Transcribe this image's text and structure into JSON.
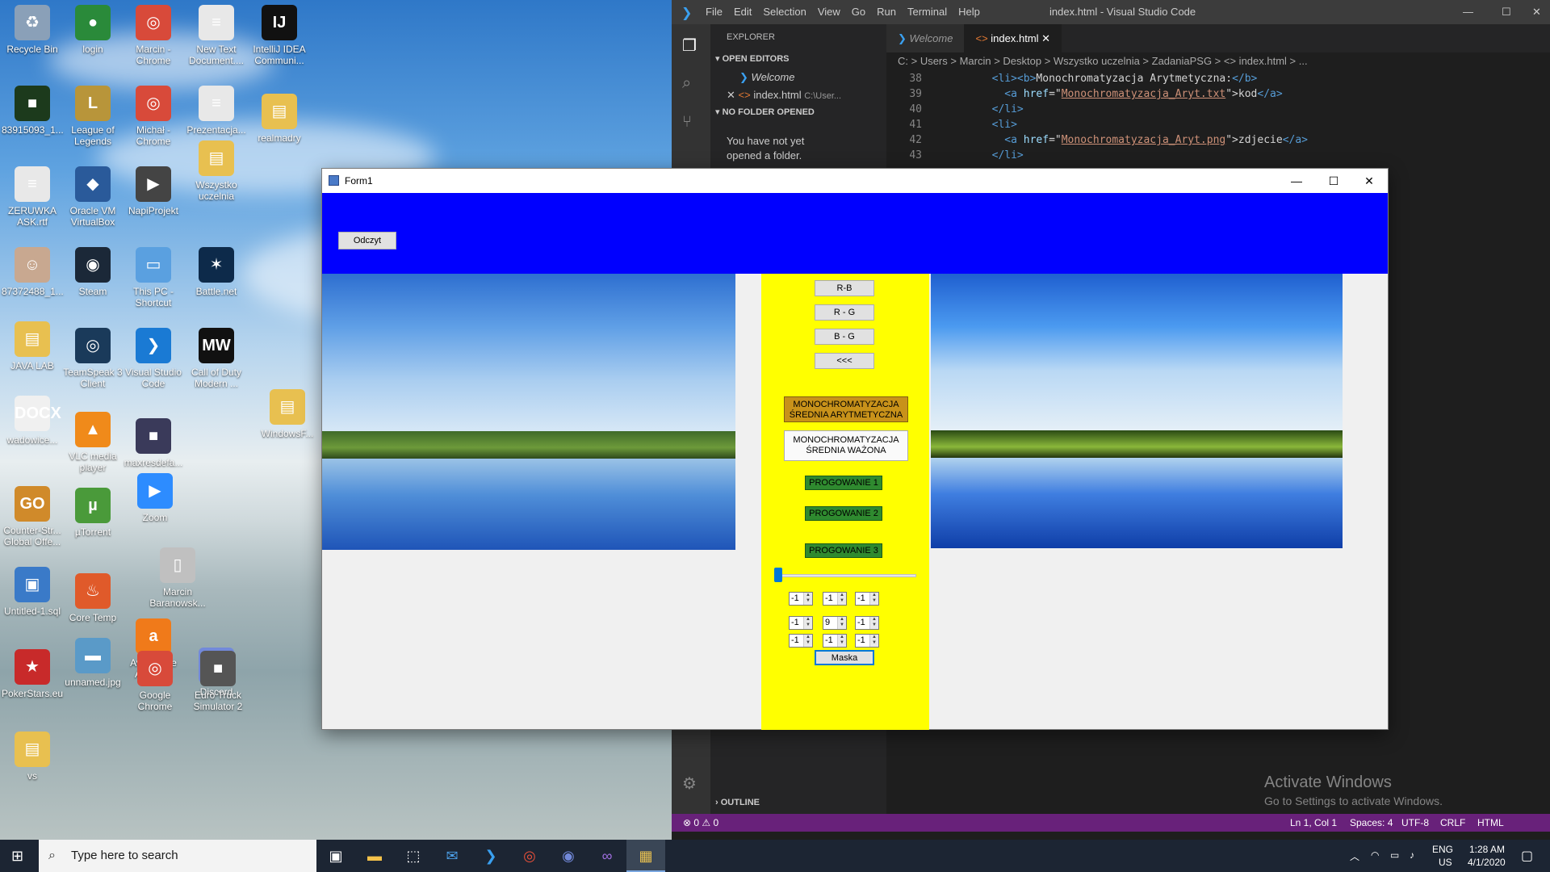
{
  "desktop": {
    "icons": [
      {
        "label": "Recycle Bin",
        "glyph": "♻",
        "color": "#8aa0b8"
      },
      {
        "label": "login",
        "glyph": "●",
        "color": "#2a8a3a"
      },
      {
        "label": "Marcin - Chrome",
        "glyph": "◎",
        "color": "#d84a3a"
      },
      {
        "label": "New Text Document....",
        "glyph": "≡",
        "color": "#e8e8e8"
      },
      {
        "label": "IntelliJ IDEA Communi...",
        "glyph": "IJ",
        "color": "#111111"
      },
      {
        "label": "83915093_1...",
        "glyph": "■",
        "color": "#1c3a1c"
      },
      {
        "label": "League of Legends",
        "glyph": "L",
        "color": "#b8953a"
      },
      {
        "label": "Michał - Chrome",
        "glyph": "◎",
        "color": "#d84a3a"
      },
      {
        "label": "Prezentacja...",
        "glyph": "≡",
        "color": "#e8e8e8"
      },
      {
        "label": "realmadry",
        "glyph": "▤",
        "color": "#e8c050"
      },
      {
        "label": "Wszystko uczelnia",
        "glyph": "▤",
        "color": "#e8c050"
      },
      {
        "label": "ZERUWKA ASK.rtf",
        "glyph": "≡",
        "color": "#e8e8e8"
      },
      {
        "label": "Oracle VM VirtualBox",
        "glyph": "◆",
        "color": "#2a5a9a"
      },
      {
        "label": "NapiProjekt",
        "glyph": "▶",
        "color": "#444444"
      },
      {
        "label": "87372488_1...",
        "glyph": "☺",
        "color": "#c8a890"
      },
      {
        "label": "Steam",
        "glyph": "◉",
        "color": "#1b2838"
      },
      {
        "label": "This PC - Shortcut",
        "glyph": "▭",
        "color": "#5aa0e0"
      },
      {
        "label": "Battle.net",
        "glyph": "✶",
        "color": "#0d2a4a"
      },
      {
        "label": "JAVA LAB",
        "glyph": "▤",
        "color": "#e8c050"
      },
      {
        "label": "TeamSpeak 3 Client",
        "glyph": "◎",
        "color": "#1a3a5a"
      },
      {
        "label": "Visual Studio Code",
        "glyph": "❯",
        "color": "#1a7ad4"
      },
      {
        "label": "Call of Duty Modern ...",
        "glyph": "MW",
        "color": "#111111"
      },
      {
        "label": "WindowsF...",
        "glyph": "▤",
        "color": "#e8c050"
      },
      {
        "label": "wadowice...",
        "glyph": "DOCX",
        "color": "#f0f0f0"
      },
      {
        "label": "VLC media player",
        "glyph": "▲",
        "color": "#f08a1a"
      },
      {
        "label": "maxresdefa...",
        "glyph": "■",
        "color": "#3a3a5a"
      },
      {
        "label": "Counter-Str... Global Offe...",
        "glyph": "GO",
        "color": "#d08a2a"
      },
      {
        "label": "µTorrent",
        "glyph": "µ",
        "color": "#4a9a3a"
      },
      {
        "label": "Zoom",
        "glyph": "▶",
        "color": "#2d8cff"
      },
      {
        "label": "Marcin Baranowsk...",
        "glyph": "▯",
        "color": "#c0c0c0"
      },
      {
        "label": "Untitled-1.sql",
        "glyph": "▣",
        "color": "#3a7ac8"
      },
      {
        "label": "Core Temp",
        "glyph": "♨",
        "color": "#e05a2a"
      },
      {
        "label": "Avast Free Antivirus",
        "glyph": "a",
        "color": "#f07a1a"
      },
      {
        "label": "Discord",
        "glyph": "◉",
        "color": "#7289da"
      },
      {
        "label": "PokerStars.eu",
        "glyph": "★",
        "color": "#c82a2a"
      },
      {
        "label": "unnamed.jpg",
        "glyph": "▬",
        "color": "#5a9ac8"
      },
      {
        "label": "Google Chrome",
        "glyph": "◎",
        "color": "#d84a3a"
      },
      {
        "label": "Euro Truck Simulator 2",
        "glyph": "■",
        "color": "#555555"
      },
      {
        "label": "vs",
        "glyph": "▤",
        "color": "#e8c050"
      }
    ]
  },
  "vscode": {
    "title": "index.html - Visual Studio Code",
    "menu": [
      "File",
      "Edit",
      "Selection",
      "View",
      "Go",
      "Run",
      "Terminal",
      "Help"
    ],
    "explorer_header": "EXPLORER",
    "open_editors_header": "OPEN EDITORS",
    "open_editors": [
      "Welcome",
      "index.html",
      "C:\\User..."
    ],
    "no_folder_header": "NO FOLDER OPENED",
    "no_folder_text": "You have not yet opened a folder.",
    "outline_header": "OUTLINE",
    "tabs": [
      "Welcome",
      "index.html"
    ],
    "breadcrumb": "C: > Users > Marcin > Desktop > Wszystko uczelnia > ZadaniaPSG > <> index.html > ...",
    "code": [
      {
        "ln": "38",
        "indent": "        ",
        "parts": [
          [
            "tag",
            "<li><b>"
          ],
          [
            "txt",
            "Monochromatyzacja Arytmetyczna:"
          ],
          [
            "tag",
            "</b>"
          ]
        ]
      },
      {
        "ln": "39",
        "indent": "          ",
        "parts": [
          [
            "tag",
            "<a "
          ],
          [
            "attr",
            "href"
          ],
          [
            "txt",
            "=\""
          ],
          [
            "str",
            "Monochromatyzacja_Aryt.txt"
          ],
          [
            "txt",
            "\">kod"
          ],
          [
            "tag",
            "</a>"
          ]
        ]
      },
      {
        "ln": "40",
        "indent": "        ",
        "parts": [
          [
            "tag",
            "</li>"
          ]
        ]
      },
      {
        "ln": "41",
        "indent": "        ",
        "parts": [
          [
            "tag",
            "<li>"
          ]
        ]
      },
      {
        "ln": "42",
        "indent": "          ",
        "parts": [
          [
            "tag",
            "<a "
          ],
          [
            "attr",
            "href"
          ],
          [
            "txt",
            "=\""
          ],
          [
            "str",
            "Monochromatyzacja_Aryt.png"
          ],
          [
            "txt",
            "\">zdjecie"
          ],
          [
            "tag",
            "</a>"
          ]
        ]
      },
      {
        "ln": "43",
        "indent": "        ",
        "parts": [
          [
            "tag",
            "</li>"
          ]
        ]
      }
    ],
    "status": {
      "problems": "⊗ 0 ⚠ 0",
      "position": "Ln 1, Col 1",
      "spaces": "Spaces: 4",
      "encoding": "UTF-8",
      "eol": "CRLF",
      "language": "HTML"
    },
    "activate_title": "Activate Windows",
    "activate_sub": "Go to Settings to activate Windows."
  },
  "form": {
    "title": "Form1",
    "read_button": "Odczyt",
    "channel_buttons": [
      "R-B",
      "R - G",
      "B - G",
      "<<<"
    ],
    "mono_arith": "MONOCHROMATYZACJA ŚREDNIA ARYTMETYCZNA",
    "mono_weighted": "MONOCHROMATYZACJA ŚREDNIA WAŻONA",
    "threshold_buttons": [
      "PROGOWANIE 1",
      "PROGOWANIE 2",
      "PROGOWANIE 3"
    ],
    "slider_value": 0,
    "mask_values": [
      "-1",
      "-1",
      "-1",
      "-1",
      "9",
      "-1",
      "-1",
      "-1",
      "-1"
    ],
    "mask_button": "Maska",
    "colors": {
      "header": "#0000ff",
      "panel": "#ffff00",
      "mono_arith": "#c8921a",
      "threshold": "#2f8a2f"
    }
  },
  "taskbar": {
    "search_placeholder": "Type here to search",
    "language": "ENG",
    "region": "US",
    "time": "1:28 AM",
    "date": "4/1/2020"
  }
}
